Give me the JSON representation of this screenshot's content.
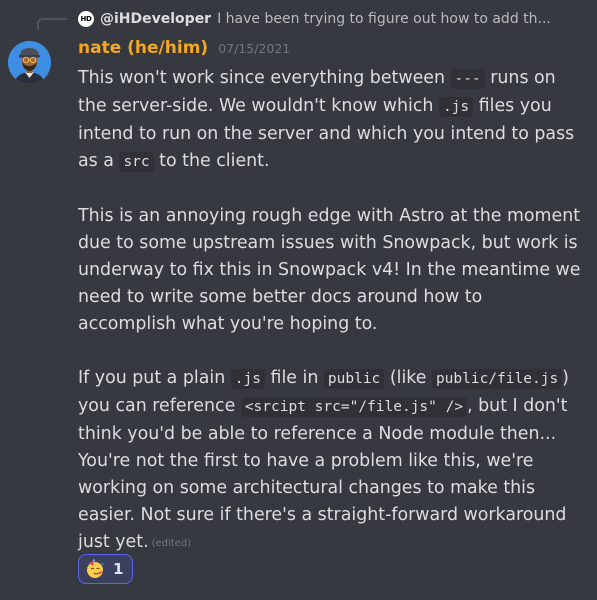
{
  "reply": {
    "avatar_text": "HD",
    "username": "@iHDeveloper",
    "snippet": "I have been trying to figure out how to add th..."
  },
  "message": {
    "author": "nate (he/him)",
    "author_color": "#f5a623",
    "timestamp": "07/15/2021",
    "edited_label": "(edited)",
    "p1": {
      "t1": "This won't work since everything between ",
      "c1": "---",
      "t2": " runs on the server-side. We wouldn't know which ",
      "c2": ".js",
      "t3": " files you intend to run on the server and which you intend to pass as a ",
      "c3": "src",
      "t4": " to the client."
    },
    "p2": "This is an annoying rough edge with Astro at the moment due to some upstream issues with Snowpack, but work is underway to fix this in Snowpack v4! In the meantime we need to write some better docs around how to accomplish what you're hoping to.",
    "p3": {
      "t1": "If you put a plain ",
      "c1": ".js",
      "t2": " file in ",
      "c2": "public",
      "t3": " (like ",
      "c3": "public/file.js",
      "t4": ") you can reference ",
      "c4": "<srcipt src=\"/file.js\" />",
      "t5": ", but I don't think you'd be able to reference a Node module then... You're not the first to have a problem like this, we're working on some architectural changes to make this easier. Not sure if there's a straight-forward workaround just yet."
    }
  },
  "reaction": {
    "emoji": "partying-face-icon",
    "count": "1",
    "accent": "#5865f2"
  },
  "colors": {
    "background": "#36393f",
    "text": "#dcddde",
    "muted": "#72767d",
    "code_bg": "#2f3136"
  }
}
